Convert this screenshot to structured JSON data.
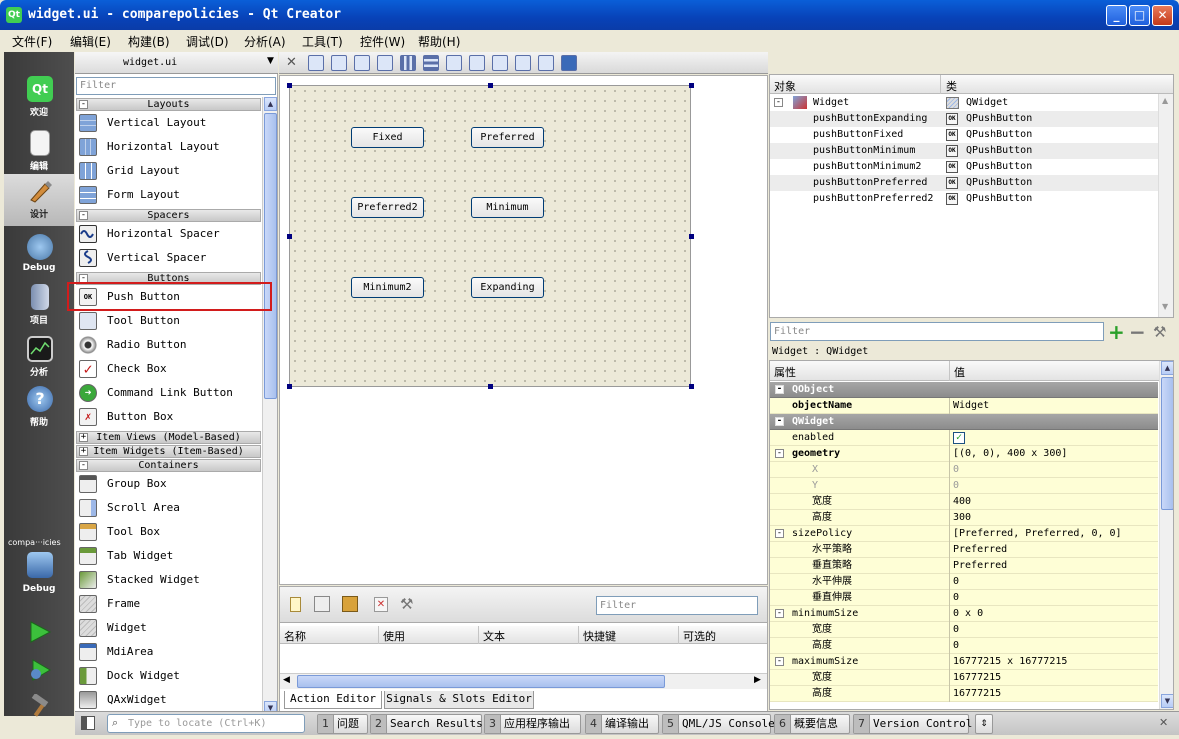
{
  "window": {
    "title": "widget.ui - comparepolicies - Qt Creator",
    "minimize": "_",
    "maximize": "□",
    "close": "✕"
  },
  "menu": [
    "文件(F)",
    "编辑(E)",
    "构建(B)",
    "调试(D)",
    "分析(A)",
    "工具(T)",
    "控件(W)",
    "帮助(H)"
  ],
  "modes": [
    {
      "label": "欢迎",
      "icon": "qt-logo-icon"
    },
    {
      "label": "编辑",
      "icon": "edit-document-icon"
    },
    {
      "label": "设计",
      "icon": "design-brush-icon",
      "active": true
    },
    {
      "label": "Debug",
      "icon": "debug-icon"
    },
    {
      "label": "项目",
      "icon": "project-icon"
    },
    {
      "label": "分析",
      "icon": "analyze-icon"
    },
    {
      "label": "帮助",
      "icon": "help-icon"
    }
  ],
  "target": {
    "project": "compa···icies",
    "label": "Debug"
  },
  "widget_box": {
    "file": "widget.ui",
    "filter_placeholder": "Filter",
    "categories": {
      "layouts": "Layouts",
      "spacers": "Spacers",
      "buttons": "Buttons",
      "item_views": "Item Views (Model-Based)",
      "item_widgets": "Item Widgets (Item-Based)",
      "containers": "Containers"
    },
    "layouts": [
      "Vertical Layout",
      "Horizontal Layout",
      "Grid Layout",
      "Form Layout"
    ],
    "spacers": [
      "Horizontal Spacer",
      "Vertical Spacer"
    ],
    "buttons": [
      "Push Button",
      "Tool Button",
      "Radio Button",
      "Check Box",
      "Command Link Button",
      "Button Box"
    ],
    "containers": [
      "Group Box",
      "Scroll Area",
      "Tool Box",
      "Tab Widget",
      "Stacked Widget",
      "Frame",
      "Widget",
      "MdiArea",
      "Dock Widget",
      "QAxWidget"
    ]
  },
  "form": {
    "buttons": [
      "Fixed",
      "Preferred",
      "Preferred2",
      "Minimum",
      "Minimum2",
      "Expanding"
    ]
  },
  "action_editor": {
    "filter_placeholder": "Filter",
    "columns": [
      "名称",
      "使用",
      "文本",
      "快捷键",
      "可选的"
    ],
    "tabs": [
      "Action Editor",
      "Signals & Slots Editor"
    ]
  },
  "object_inspector": {
    "columns": [
      "对象",
      "类"
    ],
    "rows": [
      {
        "object": "Widget",
        "class": "QWidget"
      },
      {
        "object": "pushButtonExpanding",
        "class": "QPushButton"
      },
      {
        "object": "pushButtonFixed",
        "class": "QPushButton"
      },
      {
        "object": "pushButtonMinimum",
        "class": "QPushButton"
      },
      {
        "object": "pushButtonMinimum2",
        "class": "QPushButton"
      },
      {
        "object": "pushButtonPreferred",
        "class": "QPushButton"
      },
      {
        "object": "pushButtonPreferred2",
        "class": "QPushButton"
      }
    ],
    "ok_icon_text": "OK"
  },
  "property_editor": {
    "filter_placeholder": "Filter",
    "class_label": "Widget : QWidget",
    "columns": [
      "属性",
      "值"
    ],
    "rows": [
      {
        "name": "QObject",
        "value": "",
        "section": true
      },
      {
        "name": "objectName",
        "value": "Widget",
        "bold": true
      },
      {
        "name": "QWidget",
        "value": "",
        "section": true
      },
      {
        "name": "enabled",
        "value": "✓",
        "checkbox": true
      },
      {
        "name": "geometry",
        "value": "[(0, 0), 400 x 300]",
        "bold": true,
        "expandable": true
      },
      {
        "name": "X",
        "value": "0",
        "sub": true,
        "gray": true
      },
      {
        "name": "Y",
        "value": "0",
        "sub": true,
        "gray": true
      },
      {
        "name": "宽度",
        "value": "400",
        "sub": true
      },
      {
        "name": "高度",
        "value": "300",
        "sub": true
      },
      {
        "name": "sizePolicy",
        "value": "[Preferred, Preferred, 0, 0]",
        "expandable": true
      },
      {
        "name": "水平策略",
        "value": "Preferred",
        "sub": true
      },
      {
        "name": "垂直策略",
        "value": "Preferred",
        "sub": true
      },
      {
        "name": "水平伸展",
        "value": "0",
        "sub": true
      },
      {
        "name": "垂直伸展",
        "value": "0",
        "sub": true
      },
      {
        "name": "minimumSize",
        "value": "0 x 0",
        "expandable": true
      },
      {
        "name": "宽度",
        "value": "0",
        "sub": true
      },
      {
        "name": "高度",
        "value": "0",
        "sub": true
      },
      {
        "name": "maximumSize",
        "value": "16777215 x 16777215",
        "expandable": true
      },
      {
        "name": "宽度",
        "value": "16777215",
        "sub": true
      },
      {
        "name": "高度",
        "value": "16777215",
        "sub": true
      }
    ]
  },
  "statusbar": {
    "locator_placeholder": "Type to locate (Ctrl+K)",
    "panes": [
      {
        "num": "1",
        "label": "问题"
      },
      {
        "num": "2",
        "label": "Search Results"
      },
      {
        "num": "3",
        "label": "应用程序输出"
      },
      {
        "num": "4",
        "label": "编译输出"
      },
      {
        "num": "5",
        "label": "QML/JS Console"
      },
      {
        "num": "6",
        "label": "概要信息"
      },
      {
        "num": "7",
        "label": "Version Control"
      }
    ]
  }
}
